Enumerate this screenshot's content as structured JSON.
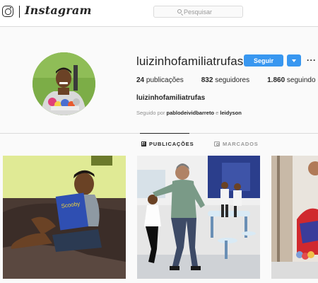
{
  "nav": {
    "wordmark": "Instagram",
    "search_placeholder": "Pesquisar"
  },
  "profile": {
    "username": "luizinhofamiliatrufas",
    "follow_label": "Seguir",
    "more_label": "···",
    "stats": {
      "posts_count": "24",
      "posts_label": "publicações",
      "followers_count": "832",
      "followers_label": "seguidores",
      "following_count": "1.860",
      "following_label": "seguindo"
    },
    "full_name": "luizinhofamiliatrufas",
    "followed_by_prefix": "Seguido por",
    "followed_by_user1": "pablodeividbarreto",
    "followed_by_conj": "e",
    "followed_by_user2": "leidyson"
  },
  "tabs": [
    {
      "label": "PUBLICAÇÕES",
      "icon": "grid-icon",
      "active": true
    },
    {
      "label": "MARCADOS",
      "icon": "tag-icon",
      "active": false
    }
  ],
  "posts": [
    {
      "name": "post-boy-reading"
    },
    {
      "name": "post-man-dancing"
    },
    {
      "name": "post-partial"
    }
  ],
  "colors": {
    "accent": "#3897f0",
    "text": "#262626",
    "muted": "#8e8e8e",
    "border": "#dbdbdb",
    "background": "#fafafa"
  }
}
